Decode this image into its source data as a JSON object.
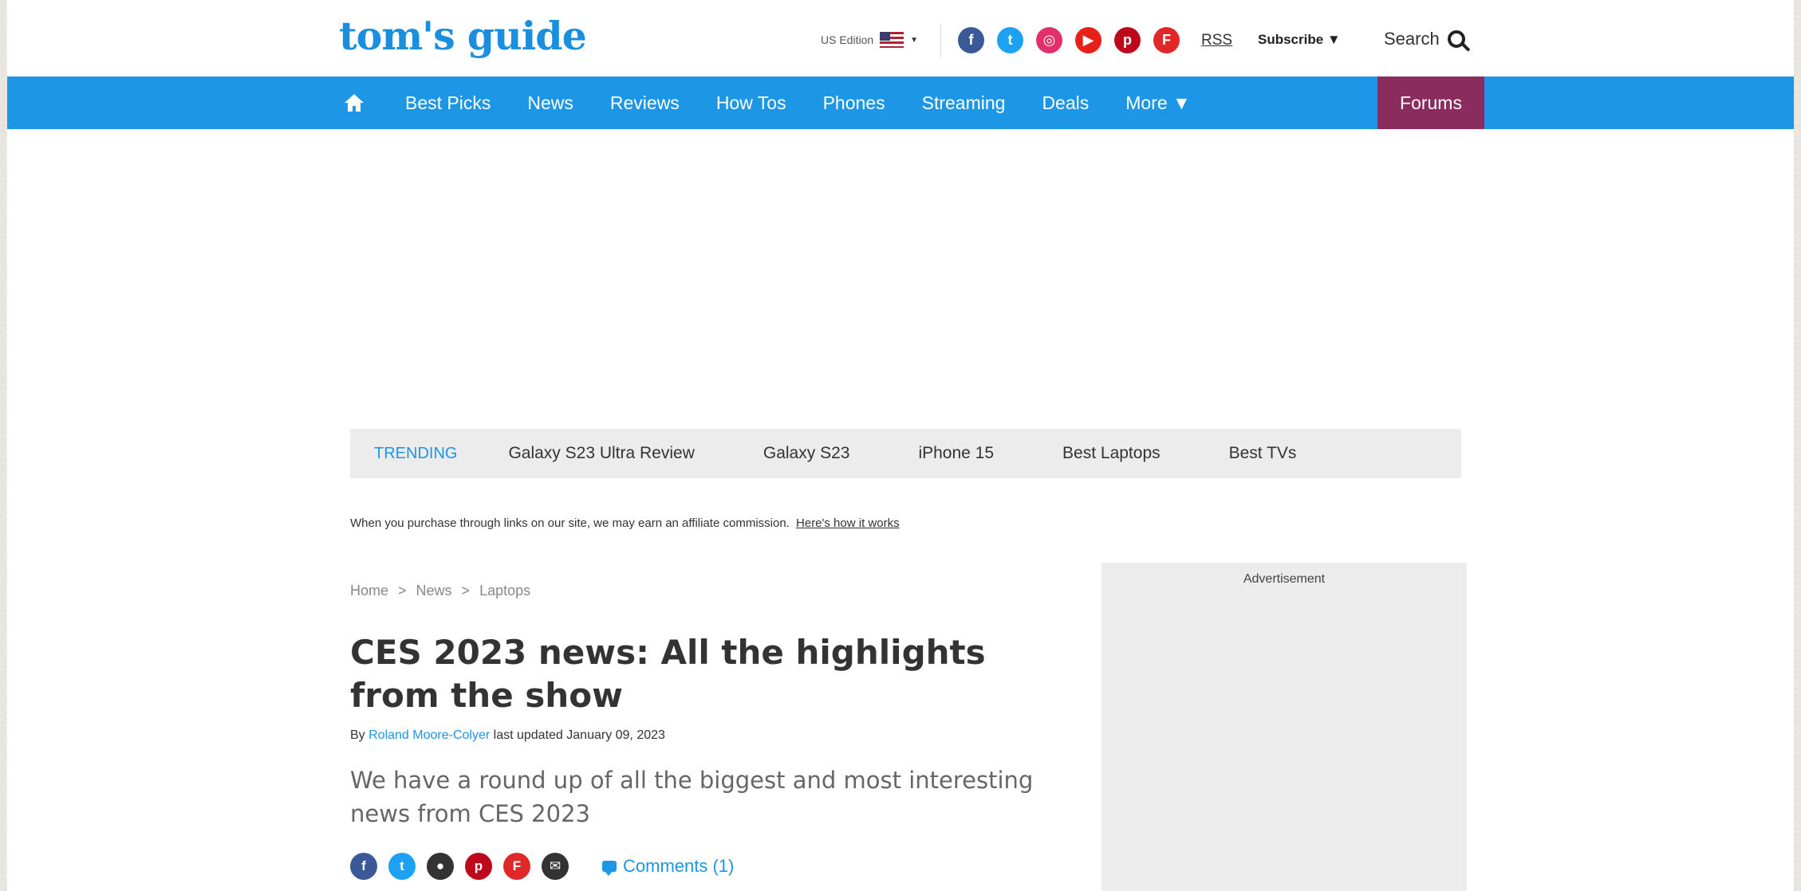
{
  "header": {
    "logo": "tom's guide",
    "edition_label": "US Edition",
    "rss_label": "RSS",
    "subscribe_label": "Subscribe ▼",
    "search_label": "Search"
  },
  "social_icons": [
    {
      "icon": "facebook-icon",
      "glyph": "f",
      "color": "#3b5998"
    },
    {
      "icon": "twitter-icon",
      "glyph": "t",
      "color": "#1da1f2"
    },
    {
      "icon": "instagram-icon",
      "glyph": "◎",
      "color": "#e1306c"
    },
    {
      "icon": "youtube-icon",
      "glyph": "▶",
      "color": "#e62117"
    },
    {
      "icon": "pinterest-icon",
      "glyph": "p",
      "color": "#bd081c"
    },
    {
      "icon": "flipboard-icon",
      "glyph": "F",
      "color": "#e12828"
    }
  ],
  "nav": {
    "items": [
      "Best Picks",
      "News",
      "Reviews",
      "How Tos",
      "Phones",
      "Streaming",
      "Deals",
      "More ▼"
    ],
    "forums": "Forums",
    "color": "#1d96e6",
    "forums_color": "#8a2c5e"
  },
  "trending": {
    "label": "TRENDING",
    "items": [
      "Galaxy S23 Ultra Review",
      "Galaxy S23",
      "iPhone 15",
      "Best Laptops",
      "Best TVs"
    ]
  },
  "affiliate": {
    "text": "When you purchase through links on our site, we may earn an affiliate commission.",
    "link": "Here's how it works"
  },
  "breadcrumb": [
    "Home",
    ">",
    "News",
    ">",
    "Laptops"
  ],
  "article": {
    "title": "CES 2023 news: All the highlights from the show",
    "by": "By",
    "author": "Roland Moore-Colyer",
    "updated": "last updated January 09, 2023",
    "subtitle": "We have a round up of all the biggest and most interesting news from CES 2023",
    "comments": "Comments (1)"
  },
  "share_icons": [
    {
      "icon": "facebook-share-icon",
      "glyph": "f",
      "color": "#3b5998"
    },
    {
      "icon": "twitter-share-icon",
      "glyph": "t",
      "color": "#1da1f2"
    },
    {
      "icon": "reddit-share-icon",
      "glyph": "●",
      "color": "#333333"
    },
    {
      "icon": "pinterest-share-icon",
      "glyph": "p",
      "color": "#bd081c"
    },
    {
      "icon": "flipboard-share-icon",
      "glyph": "F",
      "color": "#e12828"
    },
    {
      "icon": "email-share-icon",
      "glyph": "✉",
      "color": "#333333"
    }
  ],
  "ad": {
    "label": "Advertisement"
  }
}
